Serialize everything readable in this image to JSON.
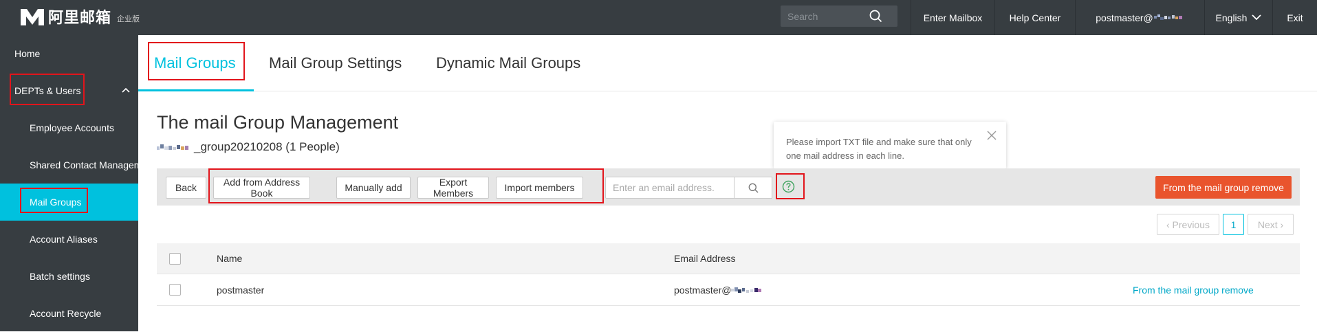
{
  "app": {
    "logo_text": "阿里邮箱",
    "edition": "企业版",
    "search_placeholder": "Search",
    "nav": {
      "enter_mailbox": "Enter Mailbox",
      "help_center": "Help Center",
      "account": "postmaster@",
      "language": "English",
      "exit": "Exit"
    }
  },
  "sidebar": {
    "items": [
      {
        "label": "Home"
      },
      {
        "label": "DEPTs & Users"
      },
      {
        "label": "Employee Accounts"
      },
      {
        "label": "Shared Contact Management"
      },
      {
        "label": "Mail Groups"
      },
      {
        "label": "Account Aliases"
      },
      {
        "label": "Batch settings"
      },
      {
        "label": "Account Recycle"
      }
    ]
  },
  "tabs": [
    {
      "label": "Mail Groups"
    },
    {
      "label": "Mail Group Settings"
    },
    {
      "label": "Dynamic Mail Groups"
    }
  ],
  "main": {
    "title": "The mail Group Management",
    "group_name": "_group20210208 (1 People)"
  },
  "tooltip": {
    "text": "Please import TXT file and make sure that only one mail address in each line."
  },
  "toolbar": {
    "back": "Back",
    "add_from_book": "Add from Address Book",
    "manually_add": "Manually add",
    "export_members": "Export Members",
    "import_members": "Import members",
    "email_placeholder": "Enter an email address.",
    "remove_button": "From the mail group remove"
  },
  "pager": {
    "previous": "‹ Previous",
    "page": "1",
    "next": "Next ›"
  },
  "table": {
    "headers": {
      "name": "Name",
      "email": "Email Address"
    },
    "rows": [
      {
        "name": "postmaster",
        "email": "postmaster@",
        "action": "From the mail group remove"
      }
    ]
  },
  "colors": {
    "accent": "#00c1de",
    "sidebar_bg": "#373d41",
    "danger": "#e9542d",
    "highlight_box": "#e2141b"
  }
}
